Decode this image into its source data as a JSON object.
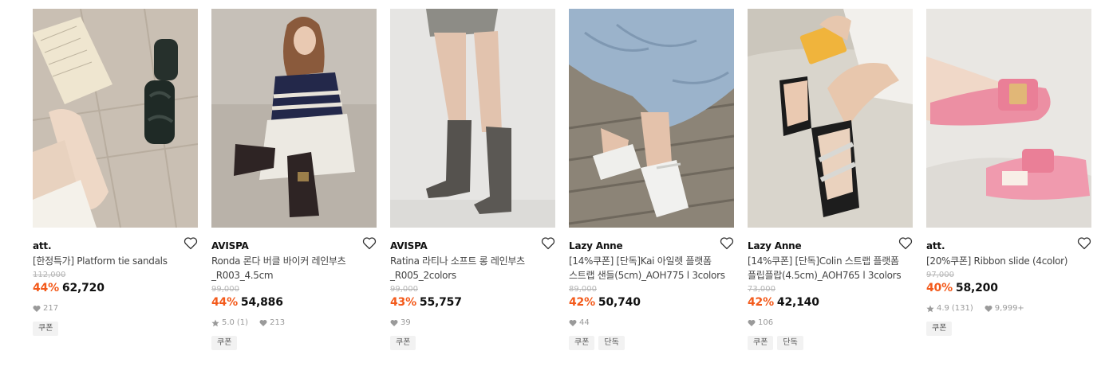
{
  "products": [
    {
      "brand": "att.",
      "name_lines": [
        "[한정특가] Platform tie sandals"
      ],
      "original_price": "112,000",
      "discount": "44%",
      "price": "62,720",
      "rating": "",
      "review_count": "",
      "likes": "217",
      "tags": [
        "쿠폰"
      ],
      "image_icon": "sandal-photo"
    },
    {
      "brand": "AVISPA",
      "name_lines": [
        "Ronda 론다 버클 바이커 레인부츠",
        "_R003_4.5cm"
      ],
      "original_price": "99,000",
      "discount": "44%",
      "price": "54,886",
      "rating": "5.0",
      "review_count": "(1)",
      "likes": "213",
      "tags": [
        "쿠폰"
      ],
      "image_icon": "biker-boot-photo"
    },
    {
      "brand": "AVISPA",
      "name_lines": [
        "Ratina 라티나 소프트 롱 레인부츠",
        "_R005_2colors"
      ],
      "original_price": "99,000",
      "discount": "43%",
      "price": "55,757",
      "rating": "",
      "review_count": "",
      "likes": "39",
      "tags": [
        "쿠폰"
      ],
      "image_icon": "rain-boot-photo"
    },
    {
      "brand": "Lazy Anne",
      "name_lines": [
        "[14%쿠폰] [단독]Kai 아일렛 플랫폼",
        "스트랩 샌들(5cm)_AOH775 l 3colors"
      ],
      "original_price": "89,000",
      "discount": "42%",
      "price": "50,740",
      "rating": "",
      "review_count": "",
      "likes": "44",
      "tags": [
        "쿠폰",
        "단독"
      ],
      "image_icon": "platform-sandal-photo"
    },
    {
      "brand": "Lazy Anne",
      "name_lines": [
        "[14%쿠폰] [단독]Colin 스트랩 플랫폼",
        "플립플랍(4.5cm)_AOH765 l 3colors"
      ],
      "original_price": "73,000",
      "discount": "42%",
      "price": "42,140",
      "rating": "",
      "review_count": "",
      "likes": "106",
      "tags": [
        "쿠폰",
        "단독"
      ],
      "image_icon": "flipflop-photo"
    },
    {
      "brand": "att.",
      "name_lines": [
        "[20%쿠폰] Ribbon slide (4color)"
      ],
      "original_price": "97,000",
      "discount": "40%",
      "price": "58,200",
      "rating": "4.9",
      "review_count": "(131)",
      "likes": "9,999+",
      "tags": [
        "쿠폰"
      ],
      "image_icon": "ribbon-slide-photo"
    }
  ],
  "colors": {
    "discount": "#f35a1b",
    "tag_bg": "#f2f2f2",
    "meta_text": "#9a9a9a"
  }
}
